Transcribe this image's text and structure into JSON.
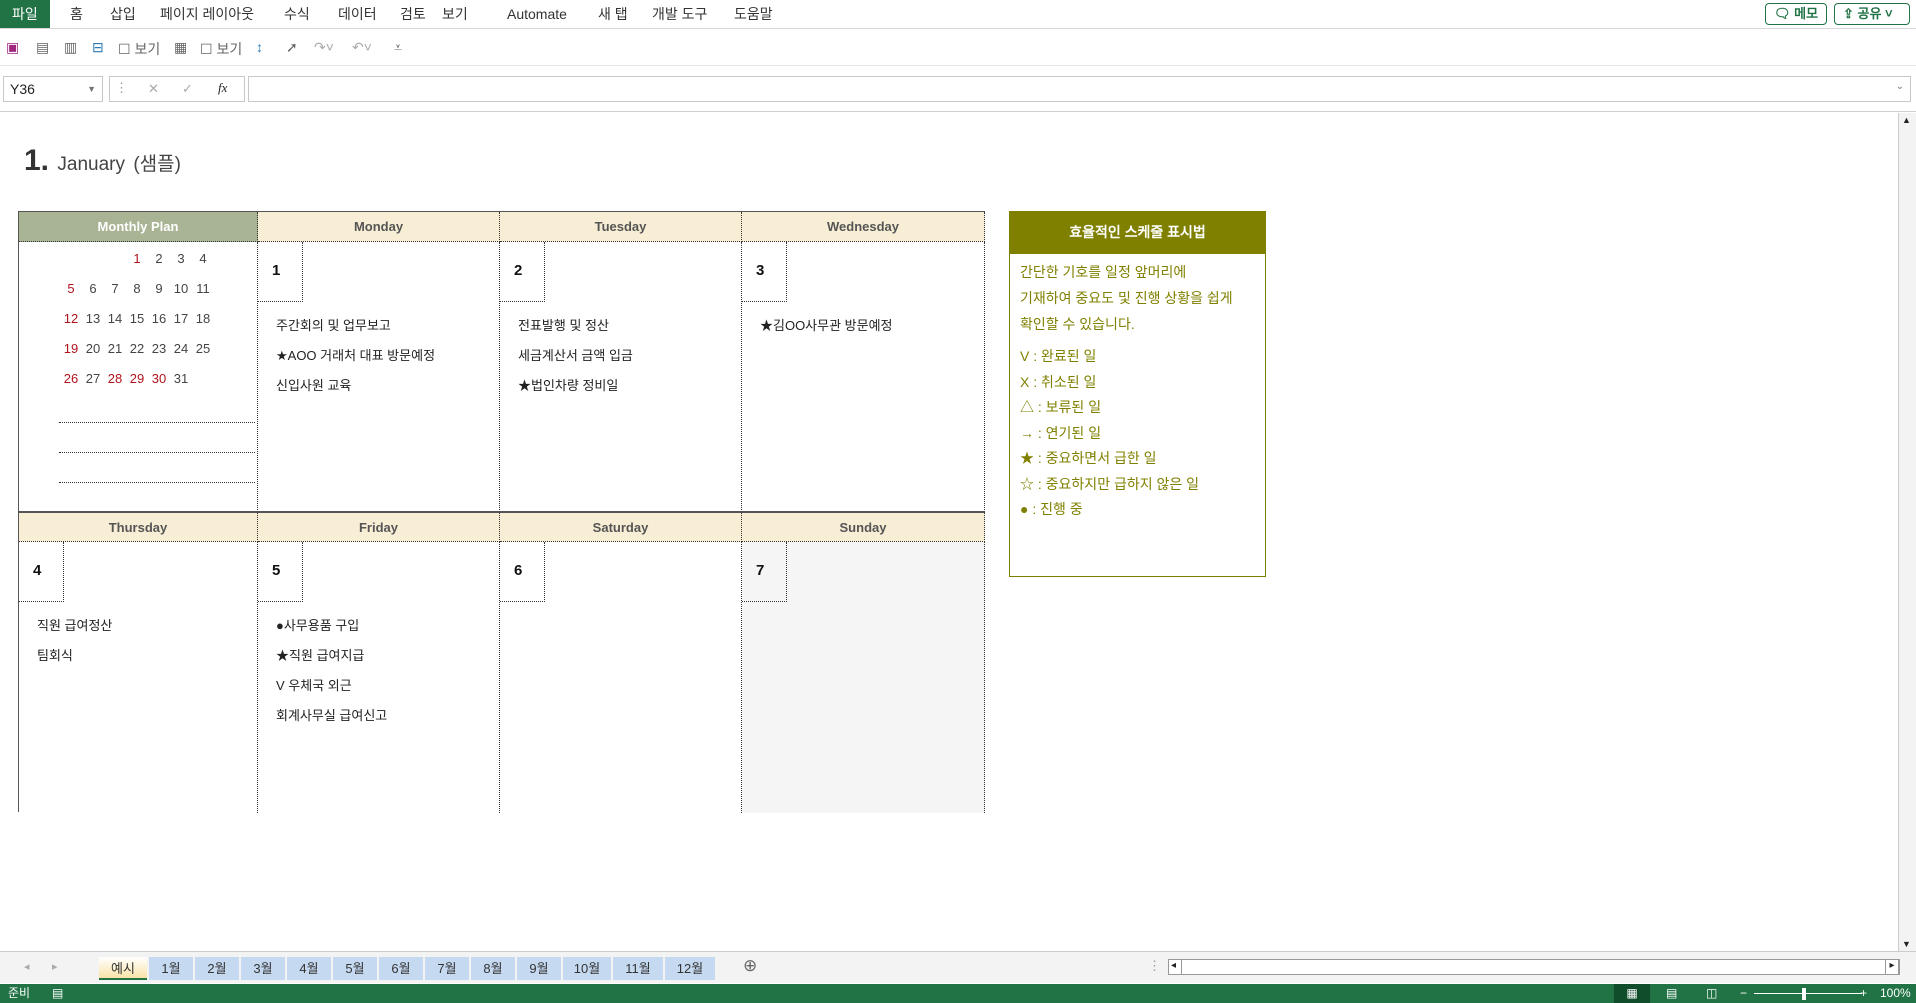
{
  "menu": {
    "items": [
      "파일",
      "홈",
      "삽입",
      "페이지 레이아웃",
      "수식",
      "데이터",
      "검토",
      "보기",
      "Automate",
      "새 탭",
      "개발 도구",
      "도움말"
    ],
    "memo": "메모",
    "share": "공유"
  },
  "qat": {
    "view1": "보기",
    "view2": "보기"
  },
  "formula": {
    "name_box": "Y36",
    "value": ""
  },
  "title": {
    "number": "1.",
    "month": "January",
    "sub": "(샘플)"
  },
  "headers": {
    "plan": "Monthly Plan",
    "days": [
      "Monday",
      "Tuesday",
      "Wednesday",
      "Thursday",
      "Friday",
      "Saturday",
      "Sunday"
    ]
  },
  "mini_calendar": [
    [
      "",
      "",
      "",
      "1",
      "2",
      "3",
      "4"
    ],
    [
      "5",
      "6",
      "7",
      "8",
      "9",
      "10",
      "11"
    ],
    [
      "12",
      "13",
      "14",
      "15",
      "16",
      "17",
      "18"
    ],
    [
      "19",
      "20",
      "21",
      "22",
      "23",
      "24",
      "25"
    ],
    [
      "26",
      "27",
      "28",
      "29",
      "30",
      "31",
      ""
    ]
  ],
  "mini_calendar_red": [
    "1",
    "5",
    "12",
    "19",
    "26",
    "28",
    "29",
    "30"
  ],
  "days": [
    {
      "date": "1",
      "events": [
        "주간회의 및 업무보고",
        "★AOO 거래처 대표 방문예정",
        "신입사원 교육"
      ]
    },
    {
      "date": "2",
      "events": [
        "전표발행 및 정산",
        "세금계산서 금액 입금",
        "★법인차량 정비일"
      ]
    },
    {
      "date": "3",
      "events": [
        "★김OO사무관 방문예정"
      ]
    },
    {
      "date": "4",
      "events": [
        "직원 급여정산",
        "팀회식"
      ]
    },
    {
      "date": "5",
      "events": [
        "●사무용품 구입",
        "★직원 급여지급",
        "V 우체국 외근",
        "회계사무실 급여신고"
      ]
    },
    {
      "date": "6",
      "events": []
    },
    {
      "date": "7",
      "events": []
    }
  ],
  "legend": {
    "title": "효율적인 스케줄 표시법",
    "intro": [
      "간단한 기호를 일정 앞머리에",
      "기재하여 중요도 및 진행 상황을 쉽게",
      "확인할 수 있습니다."
    ],
    "items": [
      "V : 완료된 일",
      "X : 취소된 일",
      "△ : 보류된 일",
      "→ : 연기된 일",
      "★ : 중요하면서 급한 일",
      "☆ : 중요하지만 급하지 않은 일",
      "● : 진행 중"
    ]
  },
  "sheets": {
    "tabs": [
      "예시",
      "1월",
      "2월",
      "3월",
      "4월",
      "5월",
      "6월",
      "7월",
      "8월",
      "9월",
      "10월",
      "11월",
      "12월"
    ],
    "active": "예시"
  },
  "status": {
    "ready": "준비",
    "zoom": "100%"
  },
  "colors": {
    "excel_green": "#217346",
    "legend_olive": "#808000",
    "header_plan": "#a9b495",
    "header_day": "#f7eed5",
    "holiday_red": "#b0141c"
  }
}
